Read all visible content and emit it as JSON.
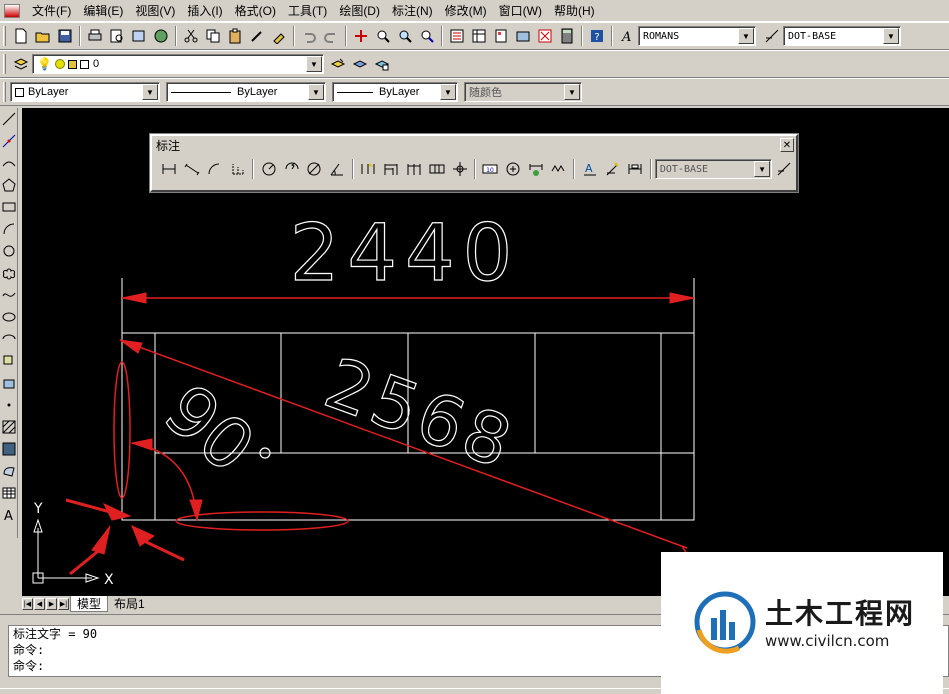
{
  "menubar": {
    "items": [
      "文件(F)",
      "编辑(E)",
      "视图(V)",
      "插入(I)",
      "格式(O)",
      "工具(T)",
      "绘图(D)",
      "标注(N)",
      "修改(M)",
      "窗口(W)",
      "帮助(H)"
    ]
  },
  "toolbar": {
    "text_style": "ROMANS",
    "dim_style": "DOT-BASE"
  },
  "layers": {
    "current_layer": "0"
  },
  "properties": {
    "color": "ByLayer",
    "linetype": "ByLayer",
    "lineweight": "ByLayer",
    "plot_style": "随颜色"
  },
  "dim_toolbar": {
    "title": "标注",
    "dim_style": "DOT-BASE"
  },
  "drawing": {
    "dim_top": "2440",
    "dim_diag": "2568",
    "dim_angle": "90",
    "dim_angle_mark": "°",
    "axis_y": "Y",
    "axis_x": "X"
  },
  "tabs": [
    "模型",
    "布局1"
  ],
  "command": {
    "lines": [
      "标注文字 = 90",
      "命令:",
      "命令:"
    ]
  },
  "watermark": {
    "title": "土木工程网",
    "url": "www.civilcn.com"
  },
  "colors": {
    "canvas": "#000000",
    "annotation": "#e02020",
    "lines": "#ffffff",
    "ui": "#d4d0c8"
  }
}
